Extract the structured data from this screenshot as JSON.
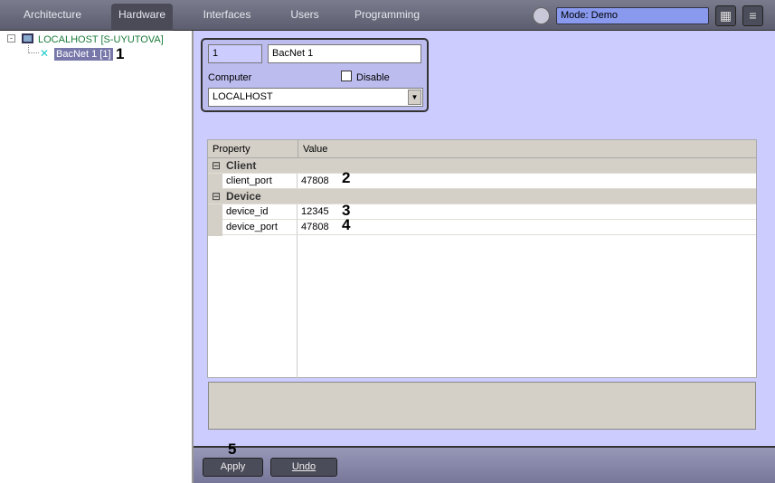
{
  "tabs": [
    "Architecture",
    "Hardware",
    "Interfaces",
    "Users",
    "Programming"
  ],
  "mode": "Mode: Demo",
  "tree": {
    "root": "LOCALHOST [S-UYUTOVA]",
    "child": "BacNet 1 [1]"
  },
  "form": {
    "id": "1",
    "name": "BacNet 1",
    "computer_label": "Computer",
    "disable_label": "Disable",
    "computer_value": "LOCALHOST"
  },
  "grid": {
    "headers": [
      "Property",
      "Value"
    ],
    "categories": [
      {
        "name": "Client",
        "rows": [
          {
            "p": "client_port",
            "v": "47808"
          }
        ]
      },
      {
        "name": "Device",
        "rows": [
          {
            "p": "device_id",
            "v": "12345"
          },
          {
            "p": "device_port",
            "v": "47808"
          }
        ]
      }
    ]
  },
  "buttons": {
    "apply": "Apply",
    "undo": "Undo"
  },
  "markers": [
    "1",
    "2",
    "3",
    "4",
    "5"
  ]
}
